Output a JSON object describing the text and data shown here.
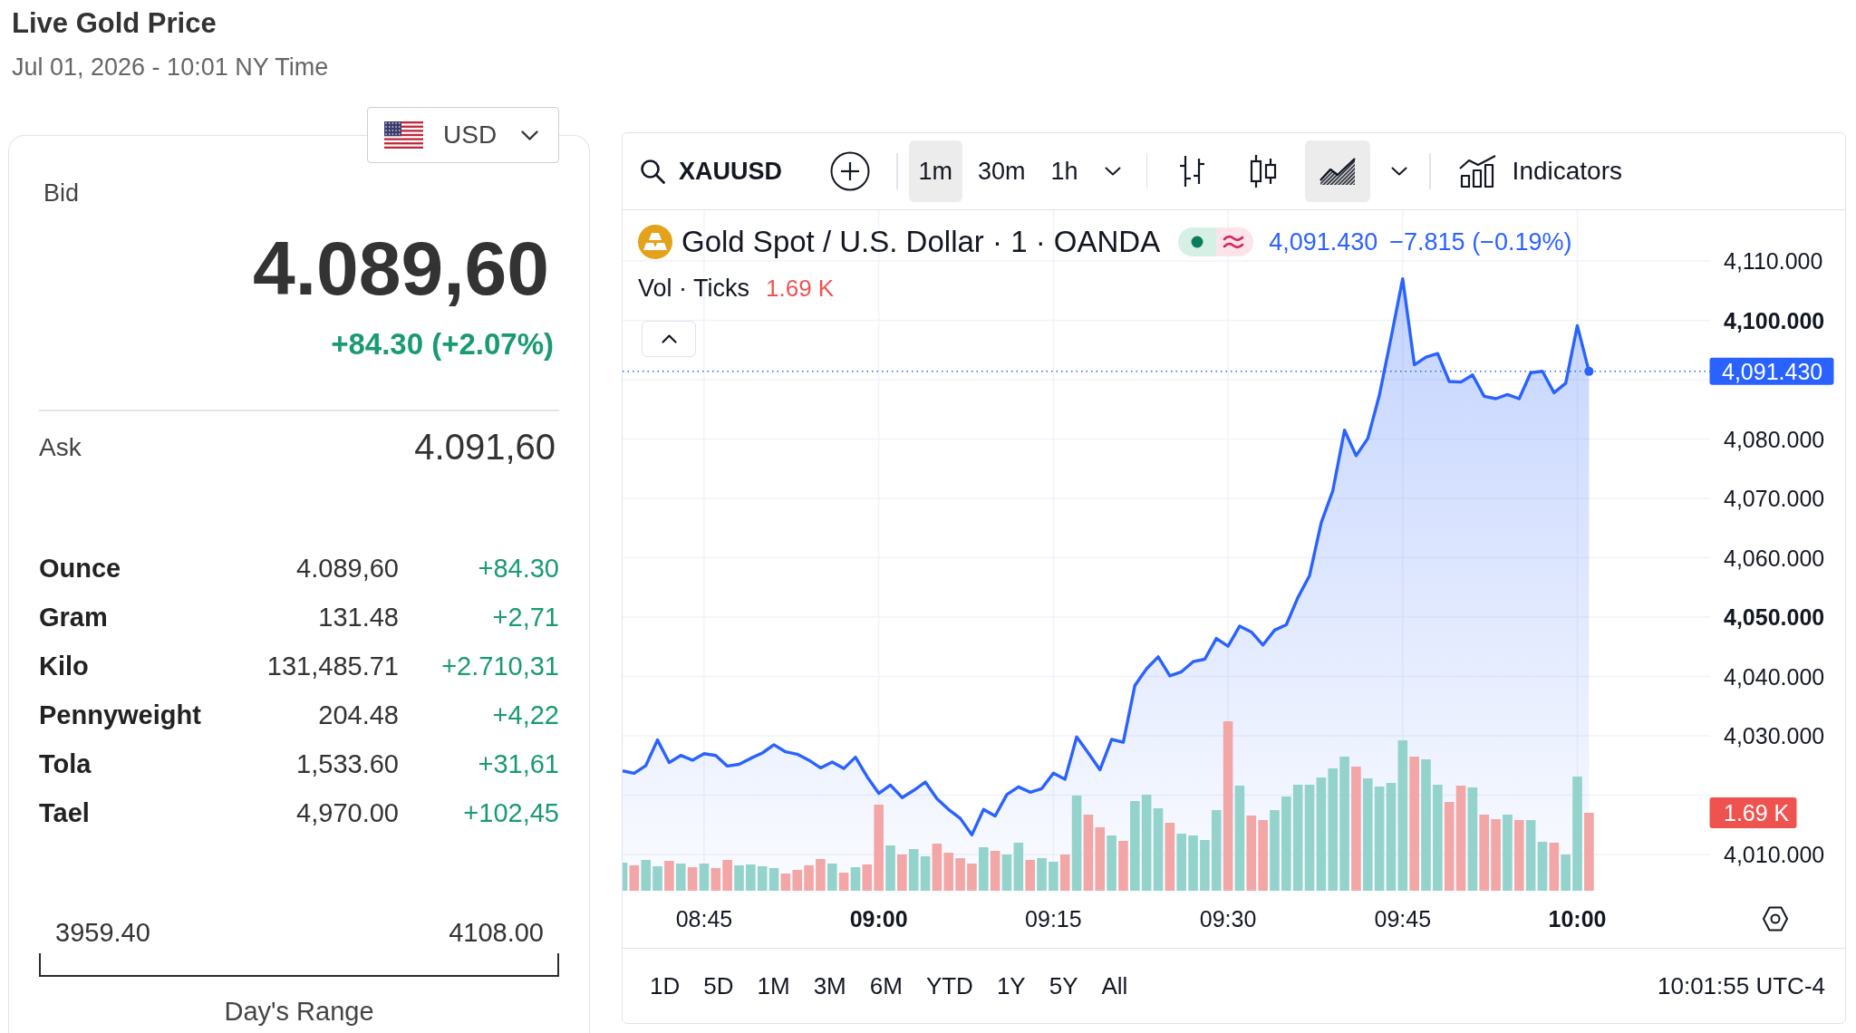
{
  "header": {
    "title": "Live Gold Price",
    "timestamp": "Jul 01, 2026 - 10:01 NY Time"
  },
  "quote_panel": {
    "currency": "USD",
    "bid": {
      "label": "Bid",
      "price": "4.089,60",
      "change": "+84.30 (+2.07%)"
    },
    "ask": {
      "label": "Ask",
      "price": "4.091,60"
    },
    "units": [
      {
        "name": "Ounce",
        "price": "4.089,60",
        "change": "+84.30"
      },
      {
        "name": "Gram",
        "price": "131.48",
        "change": "+2,71"
      },
      {
        "name": "Kilo",
        "price": "131,485.71",
        "change": "+2.710,31"
      },
      {
        "name": "Pennyweight",
        "price": "204.48",
        "change": "+4,22"
      },
      {
        "name": "Tola",
        "price": "1,533.60",
        "change": "+31,61"
      },
      {
        "name": "Tael",
        "price": "4,970.00",
        "change": "+102,45"
      }
    ],
    "day_range": {
      "low": "3959.40",
      "high": "4108.00",
      "label": "Day's Range"
    }
  },
  "chart_panel": {
    "toolbar": {
      "symbol": "XAUUSD",
      "intervals": [
        {
          "label": "1m",
          "selected": true
        },
        {
          "label": "30m",
          "selected": false
        },
        {
          "label": "1h",
          "selected": false
        }
      ],
      "chart_styles": [
        {
          "kind": "bars",
          "selected": false
        },
        {
          "kind": "candles",
          "selected": false
        },
        {
          "kind": "area",
          "selected": true
        }
      ],
      "indicators": "Indicators"
    },
    "legend": {
      "title": "Gold Spot / U.S. Dollar · 1 · OANDA",
      "market_open": true,
      "last": "4,091.430",
      "change": "−7.815 (−0.19%)",
      "volume_label": "Vol · Ticks",
      "volume_value": "1.69 K"
    },
    "chart_data": {
      "type": "area",
      "x": [
        518,
        519,
        520,
        521,
        522,
        523,
        524,
        525,
        526,
        527,
        528,
        529,
        530,
        531,
        532,
        533,
        534,
        535,
        536,
        537,
        538,
        539,
        540,
        541,
        542,
        543,
        544,
        545,
        546,
        547,
        548,
        549,
        550,
        551,
        552,
        553,
        554,
        555,
        556,
        557,
        558,
        559,
        560,
        561,
        562,
        563,
        564,
        565,
        566,
        567,
        568,
        569,
        570,
        571,
        572,
        573,
        574,
        575,
        576,
        577,
        578,
        579,
        580,
        581,
        582,
        583,
        584,
        585,
        586,
        587,
        588,
        589,
        590,
        591,
        592,
        593,
        594,
        595,
        596,
        597,
        598,
        599,
        600,
        601
      ],
      "series": [
        {
          "color": "#2962ff",
          "values": [
            4024.1,
            4023.7,
            4025.0,
            4029.3,
            4025.5,
            4026.7,
            4025.9,
            4027.0,
            4026.7,
            4024.9,
            4025.2,
            4026.2,
            4027.1,
            4028.5,
            4027.3,
            4026.9,
            4025.9,
            4024.6,
            4025.6,
            4024.5,
            4026.4,
            4023.1,
            4020.3,
            4021.7,
            4019.6,
            4020.8,
            4022.2,
            4019.4,
            4017.6,
            4016.1,
            4013.3,
            4017.6,
            4016.5,
            4020.1,
            4021.4,
            4020.5,
            4021.1,
            4023.7,
            4022.7,
            4029.8,
            4027.1,
            4024.3,
            4029.4,
            4028.9,
            4038.5,
            4041.3,
            4043.3,
            4040.1,
            4040.8,
            4042.5,
            4042.9,
            4046.4,
            4045.1,
            4048.5,
            4047.5,
            4045.3,
            4047.8,
            4048.7,
            4053.3,
            4057.0,
            4065.9,
            4071.3,
            4081.5,
            4077.2,
            4080.1,
            4087.4,
            4097.1,
            4107.0,
            4092.5,
            4093.8,
            4094.4,
            4089.7,
            4089.6,
            4090.8,
            4087.2,
            4086.8,
            4087.5,
            4086.8,
            4091.2,
            4091.4,
            4087.8,
            4089.4,
            4099.1,
            4091.4
          ]
        }
      ],
      "xlim": [
        518,
        611.4
      ],
      "ylim": [
        4003.9,
        4118.55
      ],
      "xticks": [
        {
          "value": 525,
          "label": "08:45"
        },
        {
          "value": 540,
          "label": "09:00"
        },
        {
          "value": 555,
          "label": "09:15"
        },
        {
          "value": 570,
          "label": "09:30"
        },
        {
          "value": 585,
          "label": "09:45"
        },
        {
          "value": 600,
          "label": "10:00"
        }
      ],
      "yticks": [
        {
          "value": 4110,
          "label": "4,110.000"
        },
        {
          "value": 4100,
          "label": "4,100.000"
        },
        {
          "value": 4080,
          "label": "4,080.000"
        },
        {
          "value": 4070,
          "label": "4,070.000"
        },
        {
          "value": 4060,
          "label": "4,060.000"
        },
        {
          "value": 4050,
          "label": "4,050.000"
        },
        {
          "value": 4040,
          "label": "4,040.000"
        },
        {
          "value": 4030,
          "label": "4,030.000"
        },
        {
          "value": 4010,
          "label": "4,010.000"
        }
      ],
      "grid": true,
      "ref_lines": [
        {
          "axis": "y",
          "value": 4091.4
        }
      ]
    },
    "last_price_badge": "4,091.430",
    "volume_badge": "1.69 K",
    "ranges": [
      {
        "label": "1D",
        "selected": false
      },
      {
        "label": "5D",
        "selected": false
      },
      {
        "label": "1M",
        "selected": false
      },
      {
        "label": "3M",
        "selected": false
      },
      {
        "label": "6M",
        "selected": false
      },
      {
        "label": "YTD",
        "selected": false
      },
      {
        "label": "1Y",
        "selected": false
      },
      {
        "label": "5Y",
        "selected": false
      },
      {
        "label": "All",
        "selected": false
      }
    ],
    "clock": "10:01:55 UTC-4"
  }
}
